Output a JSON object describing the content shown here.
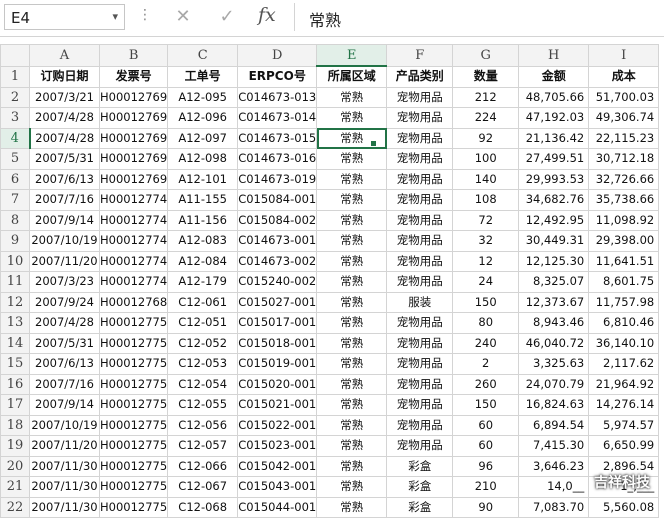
{
  "formula_bar": {
    "name_box": "E4",
    "name_box_arrow": "▾",
    "dots": "⋮",
    "cancel_icon": "✕",
    "enter_icon": "✓",
    "fx_label": "fx",
    "formula": "常熟"
  },
  "selected_cell": {
    "column": "E",
    "row": "4"
  },
  "column_headers": [
    "A",
    "B",
    "C",
    "D",
    "E",
    "F",
    "G",
    "H",
    "I"
  ],
  "row_numbers": [
    "1",
    "2",
    "3",
    "4",
    "5",
    "6",
    "7",
    "8",
    "9",
    "10",
    "11",
    "12",
    "13",
    "14",
    "15",
    "16",
    "17",
    "18",
    "19",
    "20",
    "21",
    "22"
  ],
  "header_row": [
    "订购日期",
    "发票号",
    "工单号",
    "ERPCO号",
    "所属区域",
    "产品类别",
    "数量",
    "金额",
    "成本"
  ],
  "rows": [
    [
      "2007/3/21",
      "H00012769",
      "A12-095",
      "C014673-013",
      "常熟",
      "宠物用品",
      "212",
      "48,705.66",
      "51,700.03"
    ],
    [
      "2007/4/28",
      "H00012769",
      "A12-096",
      "C014673-014",
      "常熟",
      "宠物用品",
      "224",
      "47,192.03",
      "49,306.74"
    ],
    [
      "2007/4/28",
      "H00012769",
      "A12-097",
      "C014673-015",
      "常熟",
      "宠物用品",
      "92",
      "21,136.42",
      "22,115.23"
    ],
    [
      "2007/5/31",
      "H00012769",
      "A12-098",
      "C014673-016",
      "常熟",
      "宠物用品",
      "100",
      "27,499.51",
      "30,712.18"
    ],
    [
      "2007/6/13",
      "H00012769",
      "A12-101",
      "C014673-019",
      "常熟",
      "宠物用品",
      "140",
      "29,993.53",
      "32,726.66"
    ],
    [
      "2007/7/16",
      "H00012774",
      "A11-155",
      "C015084-001",
      "常熟",
      "宠物用品",
      "108",
      "34,682.76",
      "35,738.66"
    ],
    [
      "2007/9/14",
      "H00012774",
      "A11-156",
      "C015084-002",
      "常熟",
      "宠物用品",
      "72",
      "12,492.95",
      "11,098.92"
    ],
    [
      "2007/10/19",
      "H00012774",
      "A12-083",
      "C014673-001",
      "常熟",
      "宠物用品",
      "32",
      "30,449.31",
      "29,398.00"
    ],
    [
      "2007/11/20",
      "H00012774",
      "A12-084",
      "C014673-002",
      "常熟",
      "宠物用品",
      "12",
      "12,125.30",
      "11,641.51"
    ],
    [
      "2007/3/23",
      "H00012774",
      "A12-179",
      "C015240-002",
      "常熟",
      "宠物用品",
      "24",
      "8,325.07",
      "8,601.75"
    ],
    [
      "2007/9/24",
      "H00012768",
      "C12-061",
      "C015027-001",
      "常熟",
      "服装",
      "150",
      "12,373.67",
      "11,757.98"
    ],
    [
      "2007/4/28",
      "H00012775",
      "C12-051",
      "C015017-001",
      "常熟",
      "宠物用品",
      "80",
      "8,943.46",
      "6,810.46"
    ],
    [
      "2007/5/31",
      "H00012775",
      "C12-052",
      "C015018-001",
      "常熟",
      "宠物用品",
      "240",
      "46,040.72",
      "36,140.10"
    ],
    [
      "2007/6/13",
      "H00012775",
      "C12-053",
      "C015019-001",
      "常熟",
      "宠物用品",
      "2",
      "3,325.63",
      "2,117.62"
    ],
    [
      "2007/7/16",
      "H00012775",
      "C12-054",
      "C015020-001",
      "常熟",
      "宠物用品",
      "260",
      "24,070.79",
      "21,964.92"
    ],
    [
      "2007/9/14",
      "H00012775",
      "C12-055",
      "C015021-001",
      "常熟",
      "宠物用品",
      "150",
      "16,824.63",
      "14,276.14"
    ],
    [
      "2007/10/19",
      "H00012775",
      "C12-056",
      "C015022-001",
      "常熟",
      "宠物用品",
      "60",
      "6,894.54",
      "5,974.57"
    ],
    [
      "2007/11/20",
      "H00012775",
      "C12-057",
      "C015023-001",
      "常熟",
      "宠物用品",
      "60",
      "7,415.30",
      "6,650.99"
    ],
    [
      "2007/11/30",
      "H00012775",
      "C12-066",
      "C015042-001",
      "常熟",
      "彩盒",
      "96",
      "3,646.23",
      "2,896.54"
    ],
    [
      "2007/11/30",
      "H00012775",
      "C12-067",
      "C015043-001",
      "常熟",
      "彩盒",
      "210",
      "14,0__",
      "1_,___"
    ],
    [
      "2007/11/30",
      "H00012775",
      "C12-068",
      "C015044-001",
      "常熟",
      "彩盒",
      "90",
      "7,083.70",
      "5,560.08"
    ]
  ],
  "watermark": "吉祥科技",
  "colors": {
    "accent": "#217346",
    "header_bg": "#f3f3f3",
    "grid_line": "#d4d4d4"
  }
}
